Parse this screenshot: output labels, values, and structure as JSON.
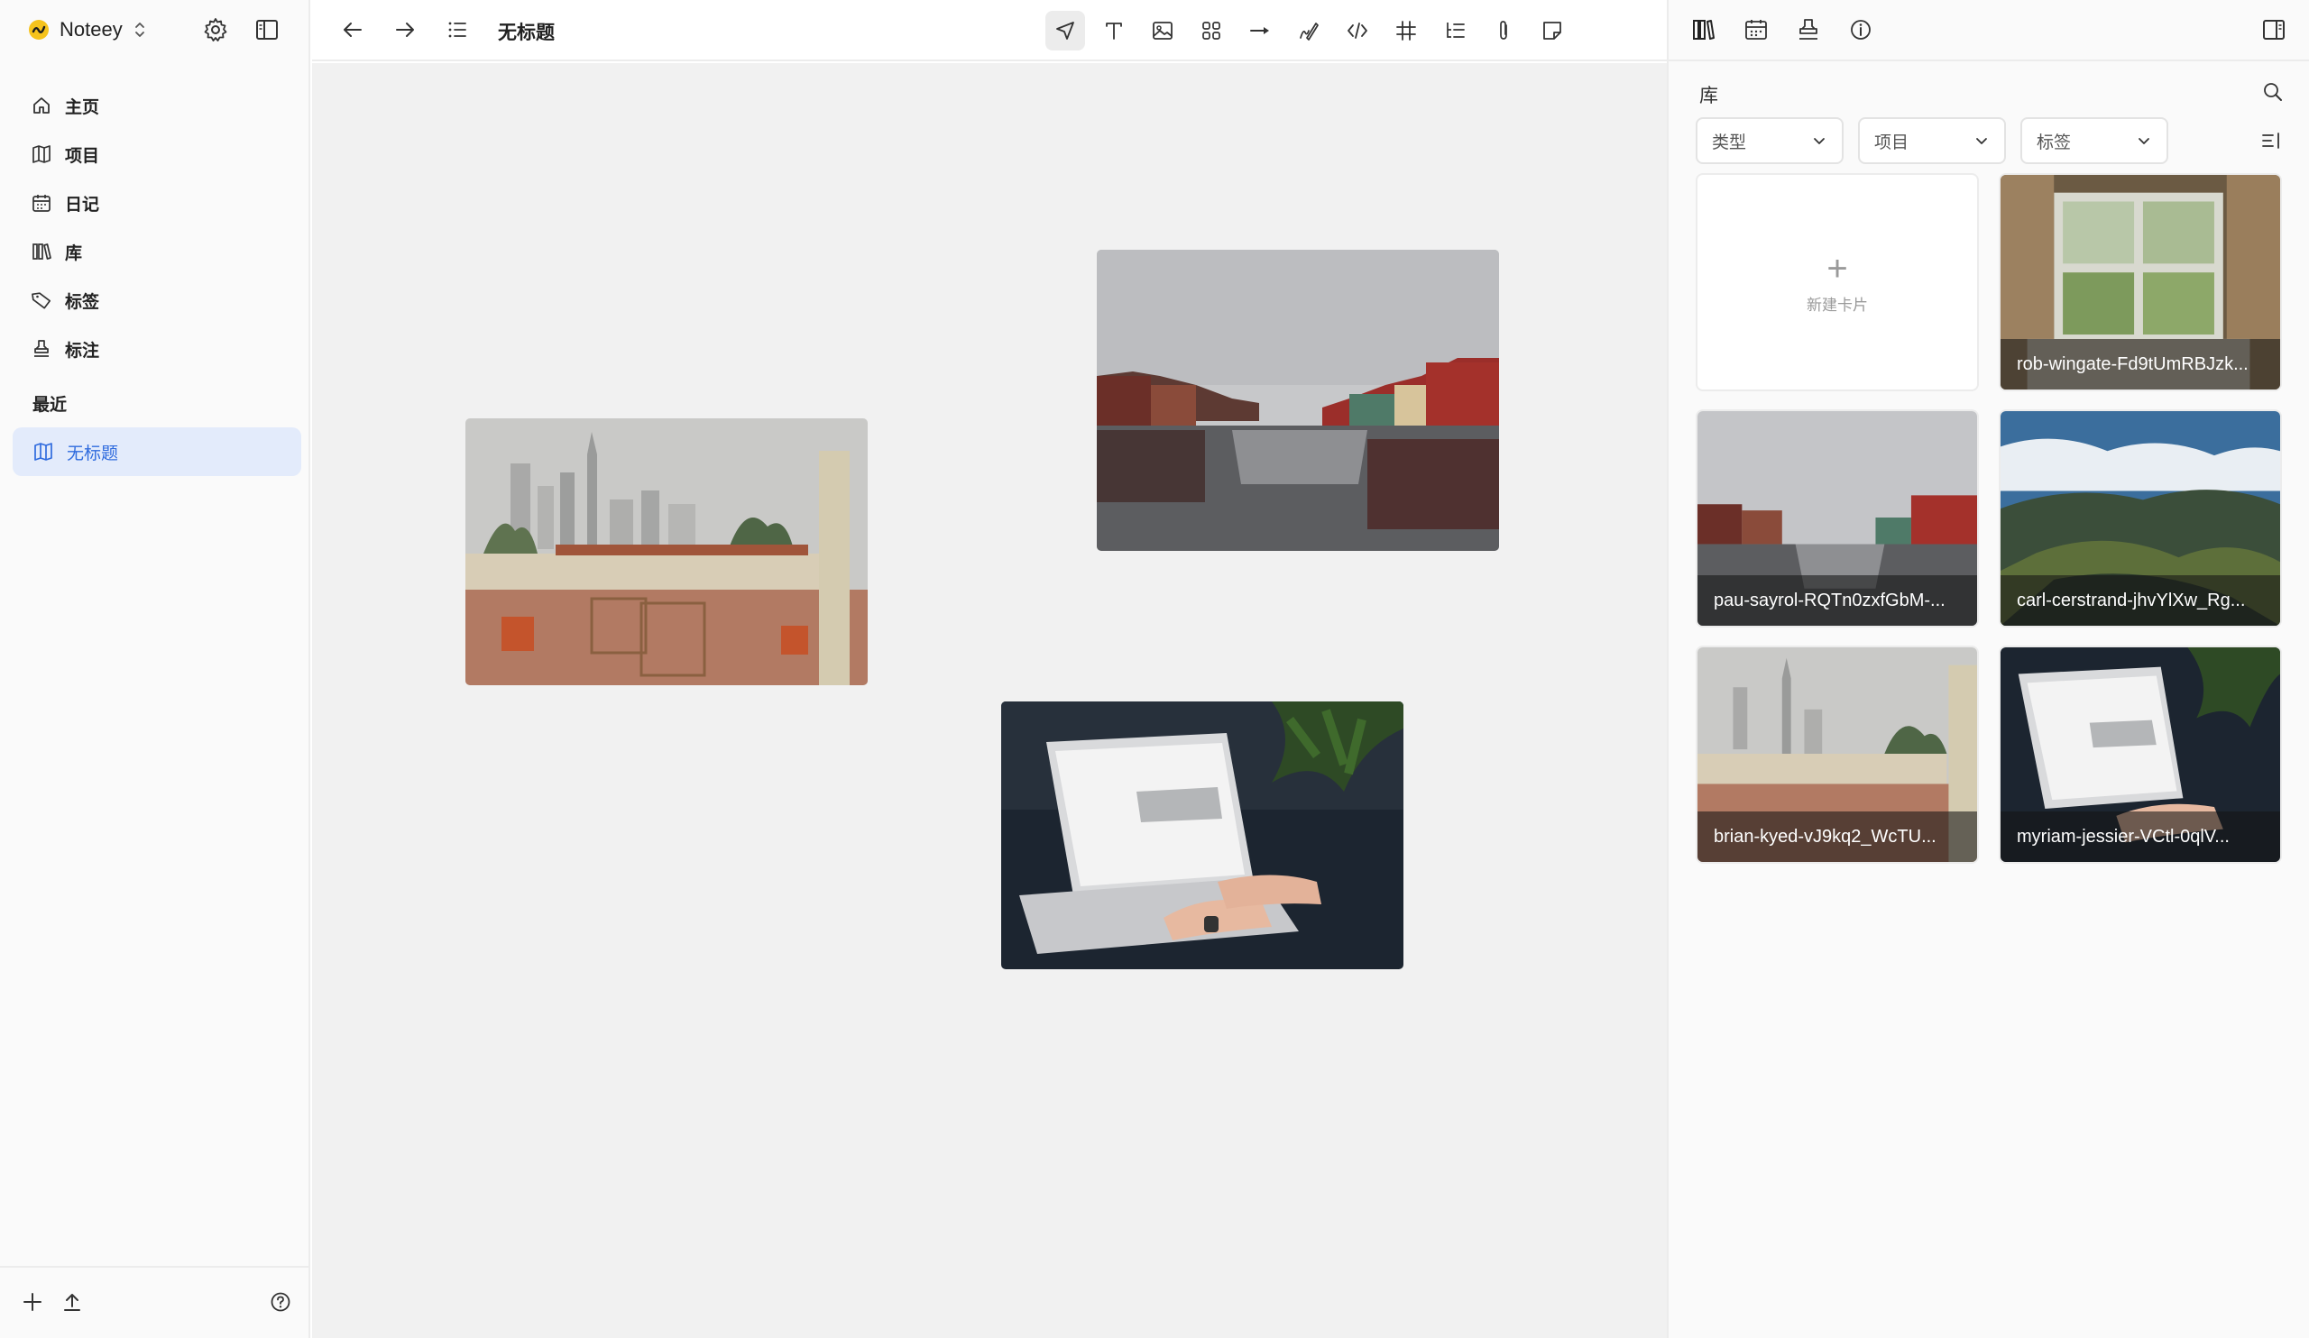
{
  "sidebar": {
    "workspace": "Noteey",
    "nav": [
      {
        "label": "主页",
        "icon": "home-icon"
      },
      {
        "label": "项目",
        "icon": "board-icon"
      },
      {
        "label": "日记",
        "icon": "calendar-icon"
      },
      {
        "label": "库",
        "icon": "library-icon"
      },
      {
        "label": "标签",
        "icon": "tag-icon"
      },
      {
        "label": "标注",
        "icon": "stamp-icon"
      }
    ],
    "recent_label": "最近",
    "recent": [
      {
        "label": "无标题",
        "icon": "board-icon"
      }
    ]
  },
  "toolbar": {
    "title": "无标题",
    "tools": [
      "select-tool",
      "text-tool",
      "image-tool",
      "shapes-tool",
      "arrow-tool",
      "draw-tool",
      "code-tool",
      "frame-tool",
      "outline-tool",
      "attachment-tool",
      "sticky-note-tool"
    ]
  },
  "library": {
    "title": "库",
    "filters": [
      "类型",
      "项目",
      "标签"
    ],
    "new_card_label": "新建卡片",
    "cards": [
      {
        "label": "rob-wingate-Fd9tUmRBJzk..."
      },
      {
        "label": "pau-sayrol-RQTn0zxfGbM-..."
      },
      {
        "label": "carl-cerstrand-jhvYlXw_Rg..."
      },
      {
        "label": "brian-kyed-vJ9kq2_WcTU..."
      },
      {
        "label": "myriam-jessier-VCtl-0qlV..."
      }
    ]
  },
  "colors": {
    "accent": "#2f6bde",
    "selected_bg": "#e3ebfb",
    "canvas_bg": "#f1f1f1"
  }
}
